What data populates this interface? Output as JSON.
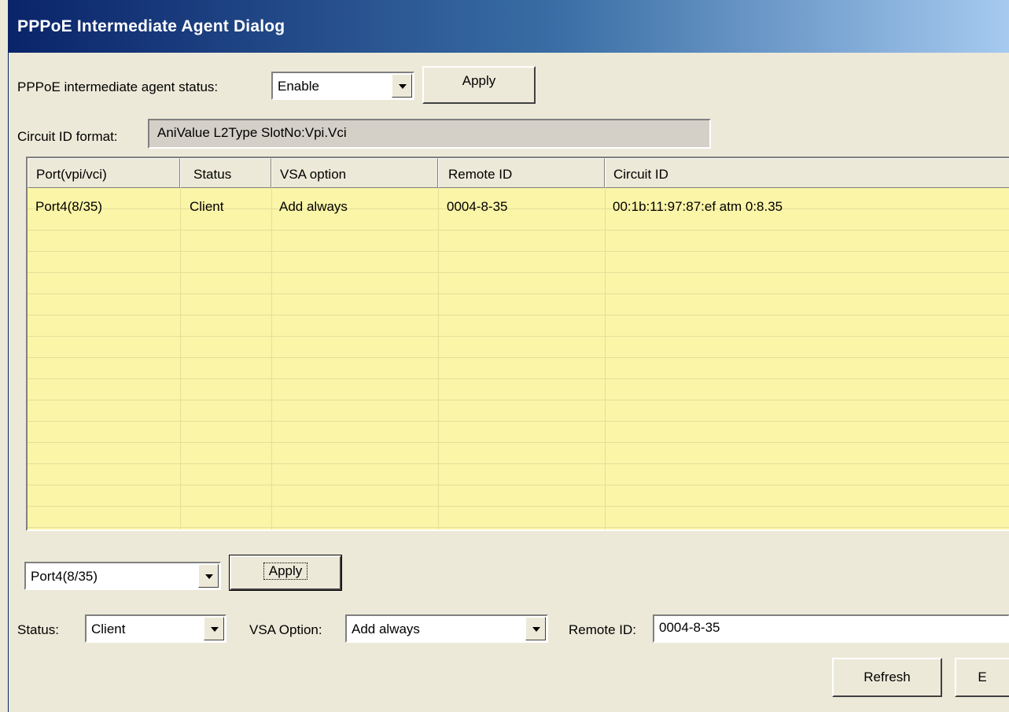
{
  "window": {
    "title": "PPPoE Intermediate Agent Dialog"
  },
  "status_row": {
    "label": "PPPoE intermediate agent status:",
    "selected": "Enable",
    "apply_label": "Apply"
  },
  "circuit_format": {
    "label": "Circuit ID format:",
    "value": "AniValue L2Type SlotNo:Vpi.Vci"
  },
  "table": {
    "columns": [
      "Port(vpi/vci)",
      "Status",
      "VSA option",
      "Remote ID",
      "Circuit ID"
    ],
    "rows": [
      [
        "Port4(8/35)",
        "Client",
        "Add always",
        "0004-8-35",
        "00:1b:11:97:87:ef atm 0:8.35"
      ]
    ]
  },
  "port_row": {
    "selected_port": "Port4(8/35)",
    "apply_label": "Apply"
  },
  "settings_row": {
    "status_label": "Status:",
    "status_value": "Client",
    "vsa_label": "VSA Option:",
    "vsa_value": "Add always",
    "remote_id_label": "Remote ID:",
    "remote_id_value": "0004-8-35"
  },
  "footer": {
    "refresh_label": "Refresh",
    "exit_label_partial": "E"
  },
  "colors": {
    "titlebar_start": "#0a246a",
    "titlebar_end": "#a6caf0",
    "grid_background": "#fbf5a8",
    "dialog_background": "#ece9d8"
  }
}
